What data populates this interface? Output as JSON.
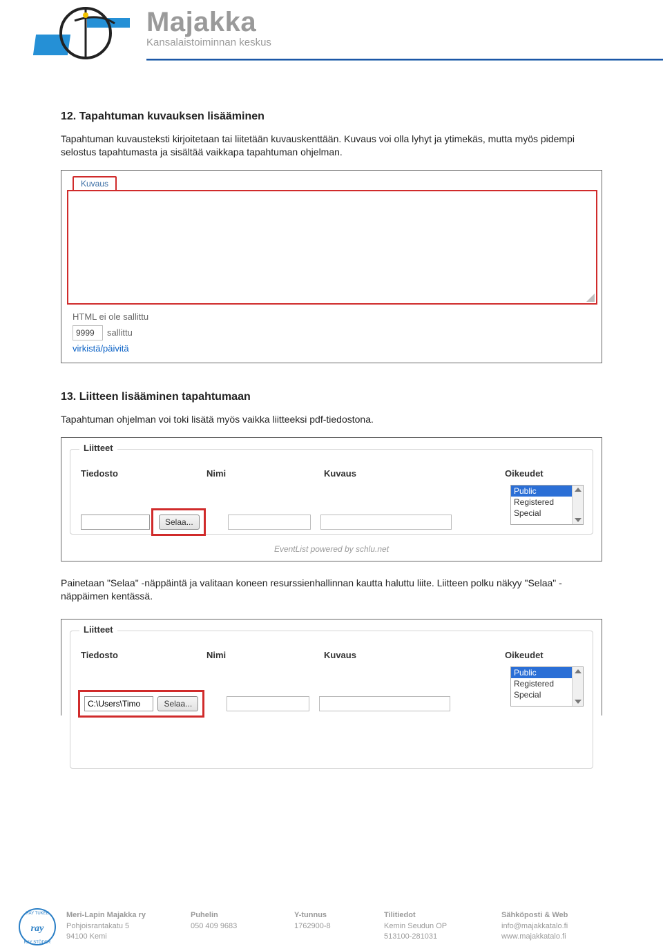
{
  "brand": {
    "title": "Majakka",
    "subtitle": "Kansalaistoiminnan keskus"
  },
  "sec12": {
    "heading": "12. Tapahtuman kuvauksen lisääminen",
    "p1": "Tapahtuman kuvausteksti kirjoitetaan tai liitetään kuvauskenttään. Kuvaus voi olla lyhyt ja ytimekäs, mutta myös pidempi selostus tapahtumasta ja sisältää vaikkapa tapahtuman ohjelman."
  },
  "shot1": {
    "tab": "Kuvaus",
    "html_note": "HTML ei ole sallittu",
    "count_value": "9999",
    "count_label": "sallittu",
    "refresh": "virkistä/päivitä"
  },
  "sec13": {
    "heading": "13. Liitteen lisääminen tapahtumaan",
    "p1": "Tapahtuman ohjelman voi toki lisätä myös vaikka liitteeksi pdf-tiedostona.",
    "p2": "Painetaan \"Selaa\" -näppäintä ja valitaan koneen resurssienhallinnan kautta haluttu liite. Liitteen polku näkyy \"Selaa\" -näppäimen kentässä."
  },
  "attach": {
    "legend": "Liitteet",
    "col_file": "Tiedosto",
    "col_name": "Nimi",
    "col_desc": "Kuvaus",
    "col_rights": "Oikeudet",
    "browse": "Selaa...",
    "rights_opts": [
      "Public",
      "Registered",
      "Special"
    ],
    "powered": "EventList powered by schlu.net"
  },
  "shot3": {
    "file_value": "C:\\Users\\Timo",
    "rights2": [
      "Public",
      "Registered"
    ]
  },
  "footer": {
    "c1": {
      "h": "Meri-Lapin Majakka ry",
      "l1": "Pohjoisrantakatu 5",
      "l2": "94100 Kemi"
    },
    "c2": {
      "h": "Puhelin",
      "l1": "050 409 9683"
    },
    "c3": {
      "h": "Y-tunnus",
      "l1": "1762900-8"
    },
    "c4": {
      "h": "Tilitiedot",
      "l1": "Kemin Seudun OP",
      "l2": "513100-281031"
    },
    "c5": {
      "h": "Sähköposti & Web",
      "l1": "info@majakkatalo.fi",
      "l2": "www.majakkatalo.fi"
    }
  }
}
